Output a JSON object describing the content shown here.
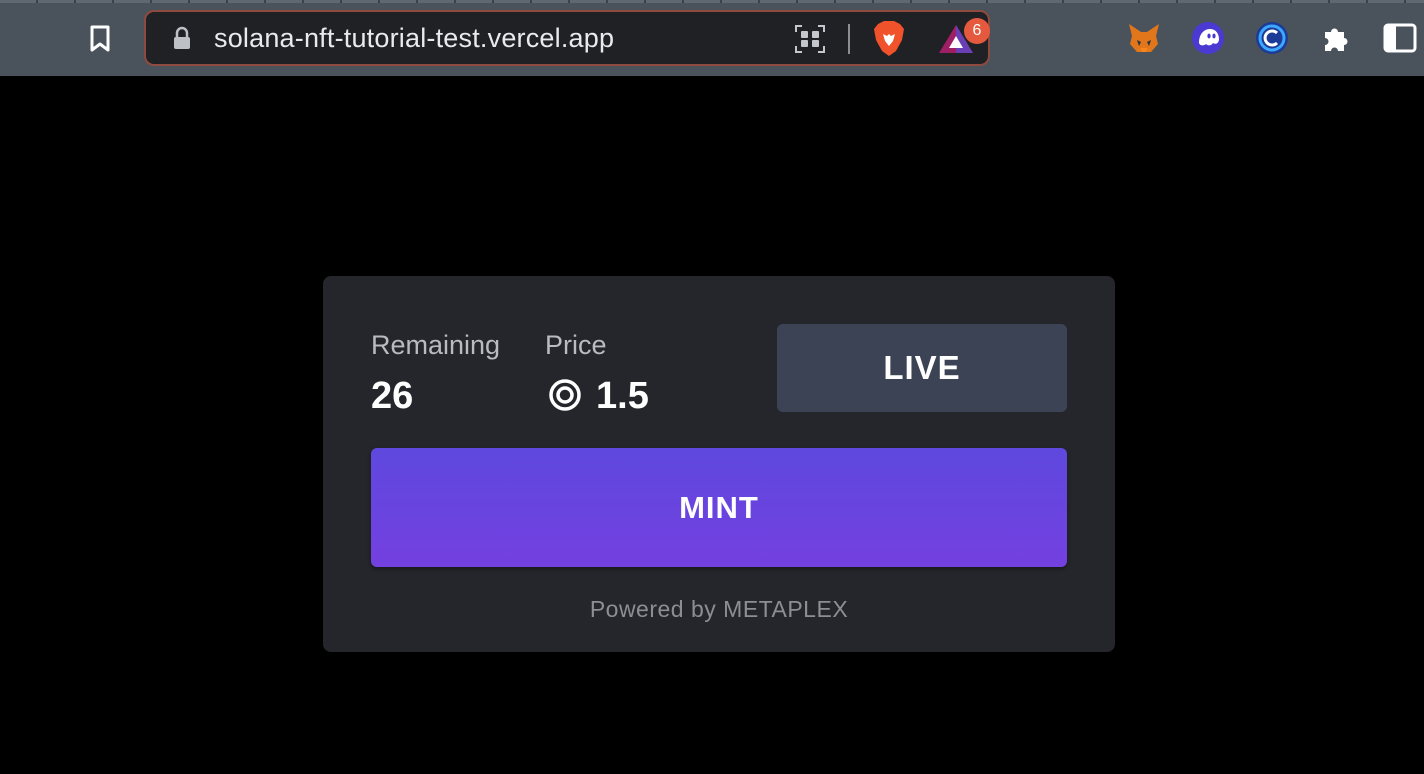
{
  "browser": {
    "url": "solana-nft-tutorial-test.vercel.app",
    "rewards_badge": "6",
    "extensions": [
      "metamask-icon",
      "phantom-icon",
      "coin98-icon",
      "extensions-puzzle-icon",
      "sidebar-icon"
    ]
  },
  "mint_card": {
    "remaining_label": "Remaining",
    "remaining_value": "26",
    "price_label": "Price",
    "price_value": "1.5",
    "status_button": "LIVE",
    "mint_button": "MINT",
    "powered_by": "Powered by METAPLEX"
  },
  "colors": {
    "page_background": "#000000",
    "card_background": "#24262b",
    "live_button": "#3b4354",
    "mint_gradient_start": "#5e48de",
    "mint_gradient_end": "#7440e0"
  }
}
